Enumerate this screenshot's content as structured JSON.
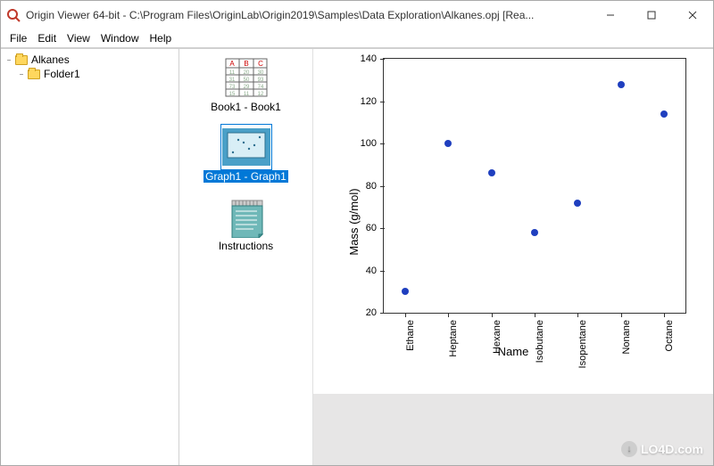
{
  "window": {
    "title": "Origin Viewer 64-bit - C:\\Program Files\\OriginLab\\Origin2019\\Samples\\Data Exploration\\Alkanes.opj [Rea...",
    "min": "—",
    "max": "☐",
    "close": "✕"
  },
  "menu": {
    "file": "File",
    "edit": "Edit",
    "view": "View",
    "window": "Window",
    "help": "Help"
  },
  "tree": {
    "root": "Alkanes",
    "child": "Folder1"
  },
  "icons": {
    "book": "Book1 - Book1",
    "graph": "Graph1 - Graph1",
    "instructions": "Instructions"
  },
  "chart_data": {
    "type": "scatter",
    "xlabel": "Name",
    "ylabel": "Mass (g/mol)",
    "ylim": [
      20,
      140
    ],
    "yticks": [
      20,
      40,
      60,
      80,
      100,
      120,
      140
    ],
    "categories": [
      "Ethane",
      "Heptane",
      "Hexane",
      "Isobutane",
      "Isopentane",
      "Nonane",
      "Octane"
    ],
    "values": [
      30,
      100,
      86,
      58,
      72,
      128,
      114
    ]
  },
  "watermark": {
    "icon": "↓",
    "text": "LO4D.com"
  }
}
